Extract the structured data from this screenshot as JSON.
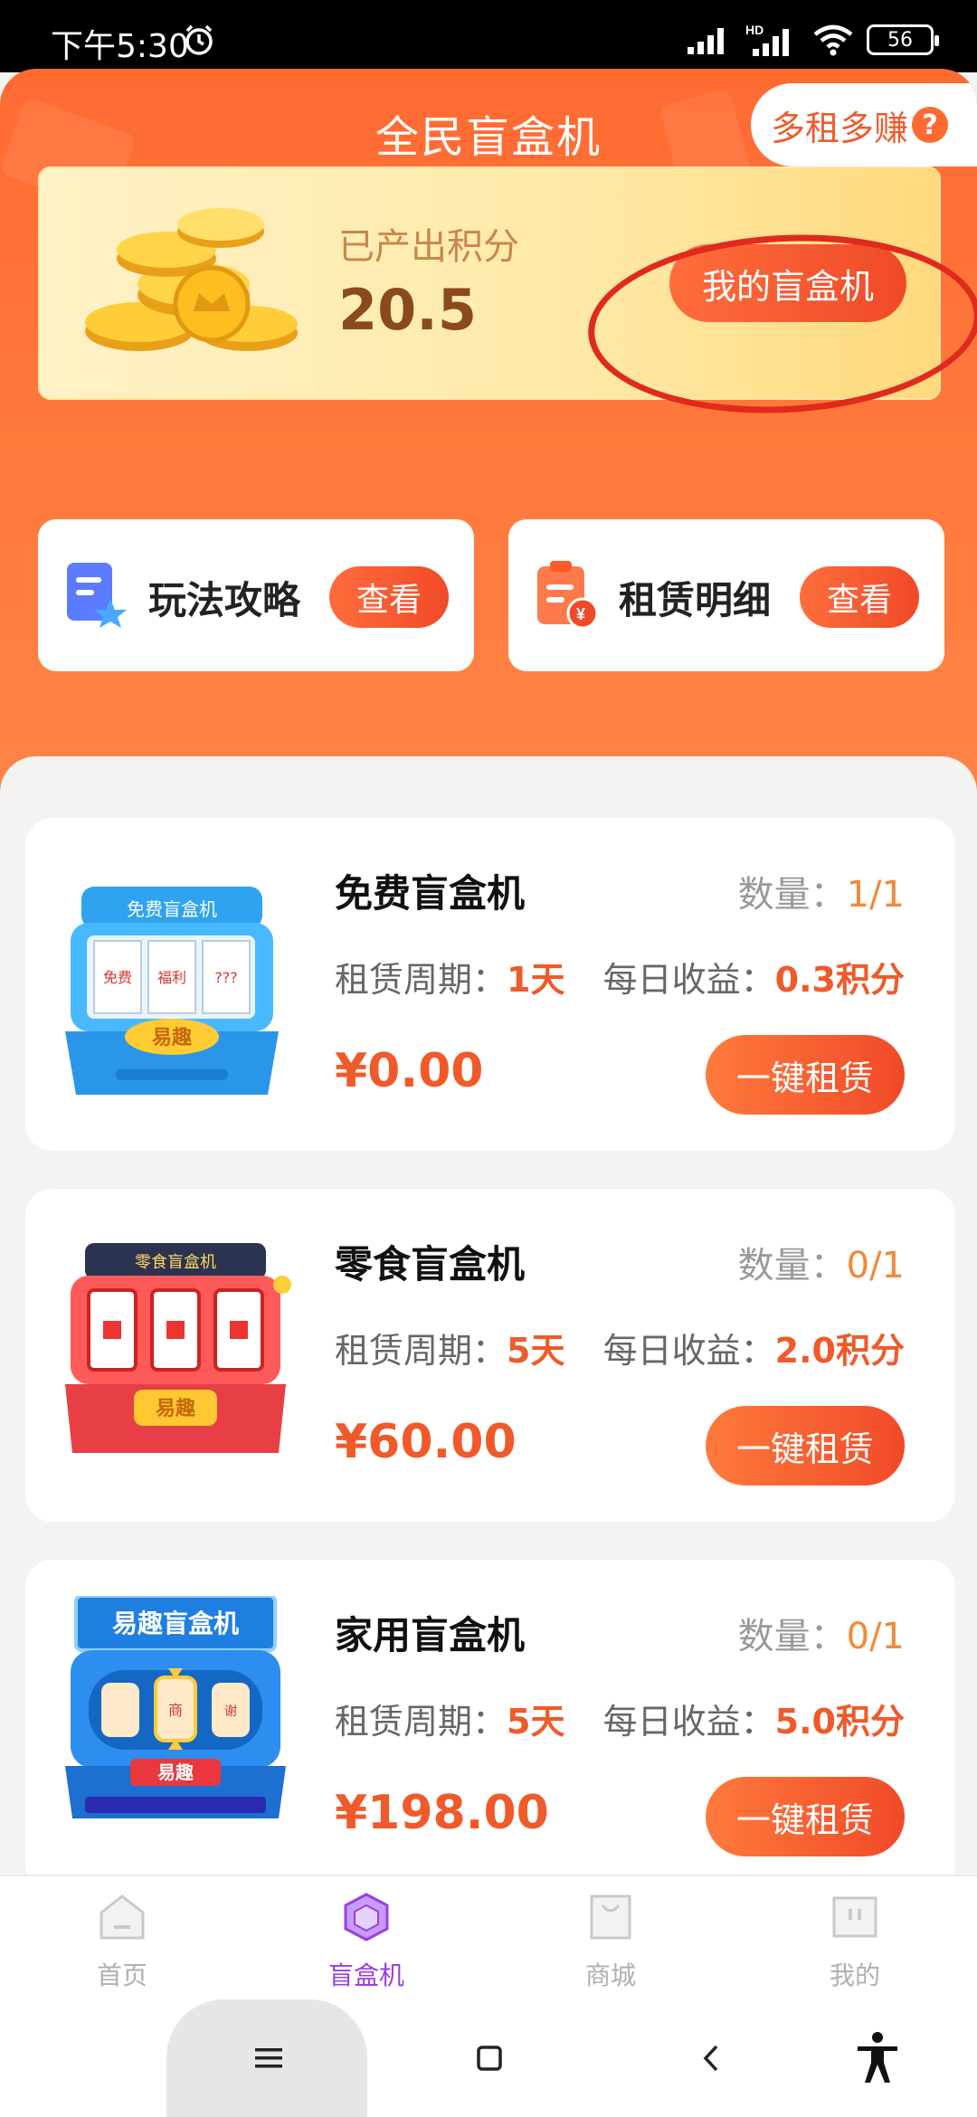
{
  "status_bar": {
    "time": "下午5:30",
    "battery": "56",
    "network_label": "HD"
  },
  "header": {
    "title": "全民盲盒机",
    "earn_more": "多租多赚",
    "help": "?"
  },
  "points": {
    "label": "已产出积分",
    "value": "20.5",
    "my_machine_button": "我的盲盒机"
  },
  "quick_links": [
    {
      "label": "玩法攻略",
      "button": "查看",
      "icon": "guide-star-icon"
    },
    {
      "label": "租赁明细",
      "button": "查看",
      "icon": "clipboard-yen-icon"
    }
  ],
  "machines": [
    {
      "name": "免费盲盒机",
      "qty_label": "数量：",
      "qty": "1/1",
      "period_label": "租赁周期：",
      "period": "1天",
      "income_label": "每日收益：",
      "income": "0.3积分",
      "price": "¥0.00",
      "button": "一键租赁",
      "img_top_text": "免费盲盒机",
      "img_reels": [
        "免费",
        "福利",
        "???"
      ],
      "img_btn": "易趣"
    },
    {
      "name": "零食盲盒机",
      "qty_label": "数量：",
      "qty": "0/1",
      "period_label": "租赁周期：",
      "period": "5天",
      "income_label": "每日收益：",
      "income": "2.0积分",
      "price": "¥60.00",
      "button": "一键租赁",
      "img_top_text": "零食盲盒机",
      "img_btn": "易趣"
    },
    {
      "name": "家用盲盒机",
      "qty_label": "数量：",
      "qty": "0/1",
      "period_label": "租赁周期：",
      "period": "5天",
      "income_label": "每日收益：",
      "income": "5.0积分",
      "price": "¥198.00",
      "button": "一键租赁",
      "img_top_text": "易趣盲盒机",
      "img_reels": [
        "",
        "商",
        "谢"
      ],
      "img_btn": "易趣"
    }
  ],
  "tabs": [
    {
      "label": "首页",
      "icon": "home-icon",
      "active": false
    },
    {
      "label": "盲盒机",
      "icon": "blindbox-icon",
      "active": true
    },
    {
      "label": "商城",
      "icon": "bag-icon",
      "active": false
    },
    {
      "label": "我的",
      "icon": "profile-icon",
      "active": false
    }
  ],
  "colors": {
    "accent": "#ff6a33",
    "price": "#f05a2a",
    "tab_active": "#9b3fe0",
    "annotation": "#e02a1d"
  }
}
